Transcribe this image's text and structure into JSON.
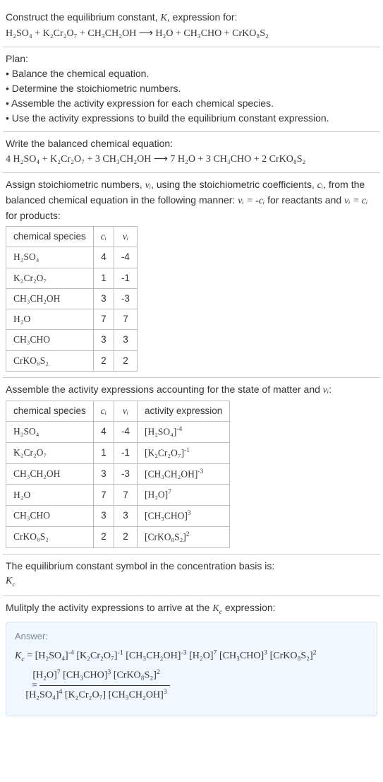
{
  "intro": {
    "line1": "Construct the equilibrium constant, ",
    "k": "K",
    "line1b": ", expression for:",
    "reaction_lhs": "H₂SO₄ + K₂Cr₂O₇ + CH₃CH₂OH",
    "arrow": "⟶",
    "reaction_rhs": "H₂O + CH₃CHO + CrKO₈S₂"
  },
  "plan": {
    "heading": "Plan:",
    "b1": "• Balance the chemical equation.",
    "b2": "• Determine the stoichiometric numbers.",
    "b3": "• Assemble the activity expression for each chemical species.",
    "b4": "• Use the activity expressions to build the equilibrium constant expression."
  },
  "balanced": {
    "heading": "Write the balanced chemical equation:",
    "lhs": "4 H₂SO₄ + K₂Cr₂O₇ + 3 CH₃CH₂OH",
    "arrow": "⟶",
    "rhs": "7 H₂O + 3 CH₃CHO + 2 CrKO₈S₂"
  },
  "assign": {
    "text_a": "Assign stoichiometric numbers, ",
    "nu": "νᵢ",
    "text_b": ", using the stoichiometric coefficients, ",
    "ci": "cᵢ",
    "text_c": ", from the balanced chemical equation in the following manner: ",
    "eq1": "νᵢ = -cᵢ",
    "text_d": " for reactants and ",
    "eq2": "νᵢ = cᵢ",
    "text_e": " for products:"
  },
  "table1": {
    "h1": "chemical species",
    "h2": "cᵢ",
    "h3": "νᵢ",
    "rows": [
      {
        "sp": "H₂SO₄",
        "c": "4",
        "v": "-4"
      },
      {
        "sp": "K₂Cr₂O₇",
        "c": "1",
        "v": "-1"
      },
      {
        "sp": "CH₃CH₂OH",
        "c": "3",
        "v": "-3"
      },
      {
        "sp": "H₂O",
        "c": "7",
        "v": "7"
      },
      {
        "sp": "CH₃CHO",
        "c": "3",
        "v": "3"
      },
      {
        "sp": "CrKO₈S₂",
        "c": "2",
        "v": "2"
      }
    ]
  },
  "assemble": {
    "text_a": "Assemble the activity expressions accounting for the state of matter and ",
    "nu": "νᵢ",
    "text_b": ":"
  },
  "table2": {
    "h1": "chemical species",
    "h2": "cᵢ",
    "h3": "νᵢ",
    "h4": "activity expression",
    "rows": [
      {
        "sp": "H₂SO₄",
        "c": "4",
        "v": "-4",
        "ae_base": "[H₂SO₄]",
        "ae_exp": "-4"
      },
      {
        "sp": "K₂Cr₂O₇",
        "c": "1",
        "v": "-1",
        "ae_base": "[K₂Cr₂O₇]",
        "ae_exp": "-1"
      },
      {
        "sp": "CH₃CH₂OH",
        "c": "3",
        "v": "-3",
        "ae_base": "[CH₃CH₂OH]",
        "ae_exp": "-3"
      },
      {
        "sp": "H₂O",
        "c": "7",
        "v": "7",
        "ae_base": "[H₂O]",
        "ae_exp": "7"
      },
      {
        "sp": "CH₃CHO",
        "c": "3",
        "v": "3",
        "ae_base": "[CH₃CHO]",
        "ae_exp": "3"
      },
      {
        "sp": "CrKO₈S₂",
        "c": "2",
        "v": "2",
        "ae_base": "[CrKO₈S₂]",
        "ae_exp": "2"
      }
    ]
  },
  "basis": {
    "text": "The equilibrium constant symbol in the concentration basis is:",
    "kc": "K",
    "kc_sub": "c"
  },
  "mult": {
    "text_a": "Mulitply the activity expressions to arrive at the ",
    "kc": "K",
    "kc_sub": "c",
    "text_b": " expression:"
  },
  "answer": {
    "label": "Answer:",
    "kc": "K",
    "kc_sub": "c",
    "eq": " = ",
    "line1_parts": [
      {
        "b": "[H₂SO₄]",
        "e": "-4"
      },
      {
        "b": "[K₂Cr₂O₇]",
        "e": "-1"
      },
      {
        "b": "[CH₃CH₂OH]",
        "e": "-3"
      },
      {
        "b": "[H₂O]",
        "e": "7"
      },
      {
        "b": "[CH₃CHO]",
        "e": "3"
      },
      {
        "b": "[CrKO₈S₂]",
        "e": "2"
      }
    ],
    "eq2": "= ",
    "num_parts": [
      {
        "b": "[H₂O]",
        "e": "7"
      },
      {
        "b": "[CH₃CHO]",
        "e": "3"
      },
      {
        "b": "[CrKO₈S₂]",
        "e": "2"
      }
    ],
    "den_parts": [
      {
        "b": "[H₂SO₄]",
        "e": "4"
      },
      {
        "b": "[K₂Cr₂O₇]",
        "e": ""
      },
      {
        "b": "[CH₃CH₂OH]",
        "e": "3"
      }
    ]
  }
}
